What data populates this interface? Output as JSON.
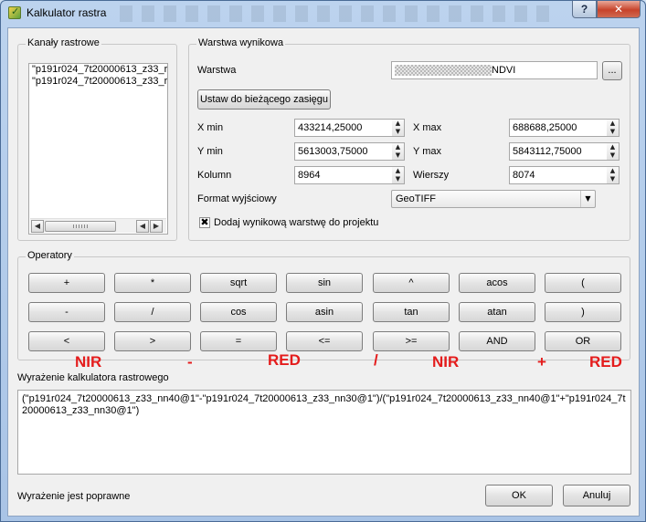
{
  "window": {
    "title": "Kalkulator rastra",
    "help_label": "?",
    "close_label": "✕"
  },
  "bands": {
    "title": "Kanały rastrowe",
    "items": [
      "\"p191r024_7t20000613_z33_r",
      "\"p191r024_7t20000613_z33_r"
    ],
    "scroll_left": "◀",
    "scroll_right": "▶"
  },
  "output": {
    "title": "Warstwa wynikowa",
    "layer_label": "Warstwa",
    "layer_value": "NDVI",
    "browse_label": "...",
    "extent_button": "Ustaw do bieżącego zasięgu",
    "xmin_label": "X min",
    "xmin_value": "433214,25000",
    "xmax_label": "X max",
    "xmax_value": "688688,25000",
    "ymin_label": "Y min",
    "ymin_value": "5613003,75000",
    "ymax_label": "Y max",
    "ymax_value": "5843112,75000",
    "columns_label": "Kolumn",
    "columns_value": "8964",
    "rows_label": "Wierszy",
    "rows_value": "8074",
    "format_label": "Format wyjściowy",
    "format_value": "GeoTIFF",
    "add_to_project_label": "Dodaj wynikową warstwę do projektu",
    "add_to_project_checked": true
  },
  "operators": {
    "title": "Operatory",
    "rows": [
      [
        "+",
        "*",
        "sqrt",
        "sin",
        "^",
        "acos",
        "("
      ],
      [
        "-",
        "/",
        "cos",
        "asin",
        "tan",
        "atan",
        ")"
      ],
      [
        "<",
        ">",
        "=",
        "<=",
        ">=",
        "AND",
        "OR"
      ]
    ]
  },
  "annotations": {
    "color": "#e41c1c",
    "items": [
      "NIR",
      "-",
      "RED",
      "/",
      "NIR",
      "+",
      "RED"
    ]
  },
  "expression": {
    "label": "Wyrażenie kalkulatora rastrowego",
    "value": "(\"p191r024_7t20000613_z33_nn40@1\"-\"p191r024_7t20000613_z33_nn30@1\")/(\"p191r024_7t20000613_z33_nn40@1\"+\"p191r024_7t20000613_z33_nn30@1\")",
    "status": "Wyrażenie jest poprawne"
  },
  "buttons": {
    "ok": "OK",
    "cancel": "Anuluj"
  }
}
